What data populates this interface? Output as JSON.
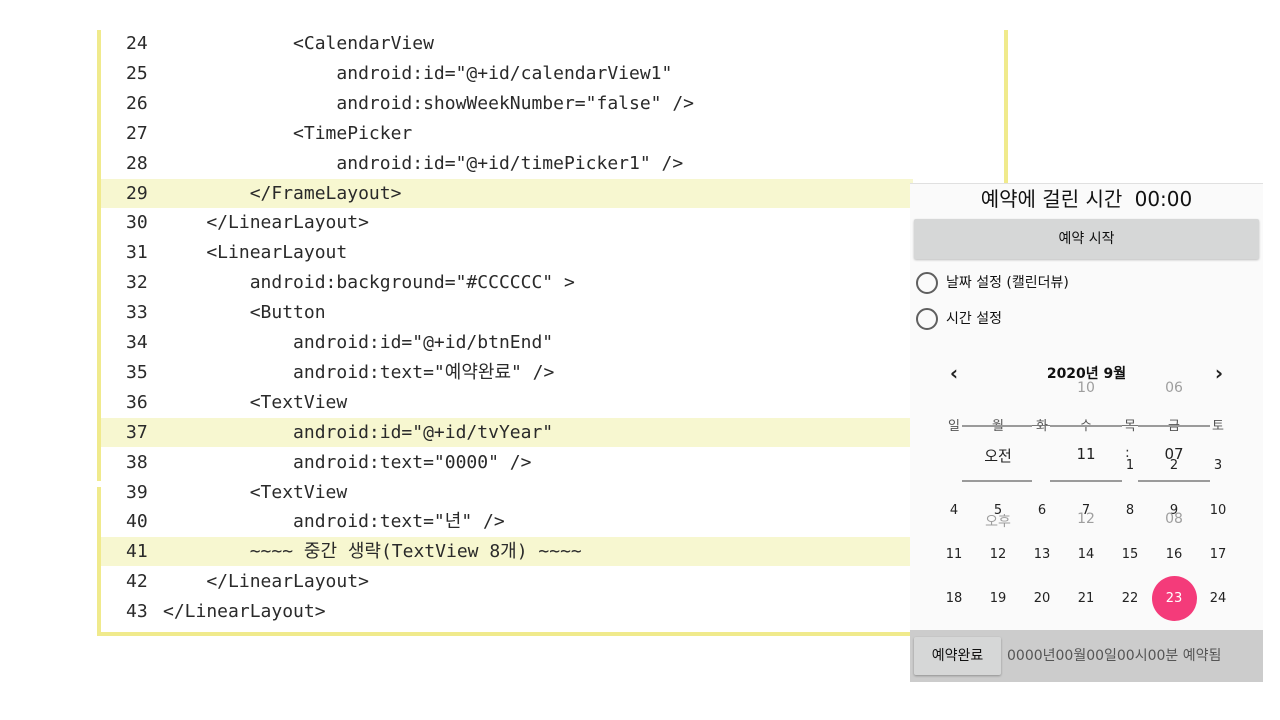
{
  "code": {
    "lines": [
      {
        "num": "24",
        "text": "            <CalendarView",
        "highlight": false
      },
      {
        "num": "25",
        "text": "                android:id=\"@+id/calendarView1\"",
        "highlight": false
      },
      {
        "num": "26",
        "text": "                android:showWeekNumber=\"false\" />",
        "highlight": false
      },
      {
        "num": "27",
        "text": "            <TimePicker",
        "highlight": false
      },
      {
        "num": "28",
        "text": "                android:id=\"@+id/timePicker1\" />",
        "highlight": false
      },
      {
        "num": "29",
        "text": "        </FrameLayout>",
        "highlight": true
      },
      {
        "num": "30",
        "text": "    </LinearLayout>",
        "highlight": false
      },
      {
        "num": "31",
        "text": "    <LinearLayout",
        "highlight": false
      },
      {
        "num": "32",
        "text": "        android:background=\"#CCCCCC\" >",
        "highlight": false
      },
      {
        "num": "33",
        "text": "        <Button",
        "highlight": false
      },
      {
        "num": "34",
        "text": "            android:id=\"@+id/btnEnd\"",
        "highlight": false
      },
      {
        "num": "35",
        "text": "            android:text=\"예약완료\" />",
        "highlight": false
      },
      {
        "num": "36",
        "text": "        <TextView",
        "highlight": false
      },
      {
        "num": "37",
        "text": "            android:id=\"@+id/tvYear\"",
        "highlight": true
      },
      {
        "num": "38",
        "text": "            android:text=\"0000\" />",
        "highlight": false
      },
      {
        "num": "39",
        "text": "        <TextView",
        "highlight": false
      },
      {
        "num": "40",
        "text": "            android:text=\"년\" />",
        "highlight": false
      },
      {
        "num": "41",
        "text": "        ~~~~ 중간 생략(TextView 8개) ~~~~",
        "highlight": true
      },
      {
        "num": "42",
        "text": "    </LinearLayout>",
        "highlight": false
      },
      {
        "num": "43",
        "text": "</LinearLayout>",
        "highlight": false
      }
    ]
  },
  "phone": {
    "elapsed_label": "예약에 걸린 시간",
    "elapsed_value": "00:00",
    "start_button": "예약 시작",
    "radio_date": "날짜 설정 (캘린더뷰)",
    "radio_time": "시간 설정",
    "calendar": {
      "title": "2020년 9월",
      "weekdays": [
        "일",
        "월",
        "화",
        "수",
        "목",
        "금",
        "토"
      ],
      "rows": [
        [
          "",
          "",
          "",
          "",
          "",
          "",
          "3"
        ],
        [
          "4",
          "5",
          "6",
          "7",
          "8",
          "9",
          "10"
        ],
        [
          "11",
          "12",
          "13",
          "14",
          "15",
          "16",
          "17"
        ],
        [
          "18",
          "19",
          "20",
          "21",
          "22",
          "23",
          "24"
        ]
      ],
      "row1_partial": [
        "1",
        "2"
      ],
      "selected_day": "23"
    },
    "time_picker": {
      "ampm_prev": "",
      "ampm_current": "오전",
      "ampm_next": "오후",
      "hour_prev": "10",
      "hour_current": "11",
      "hour_next": "12",
      "minute_prev": "06",
      "minute_current": "07",
      "minute_next": "08",
      "separator": ":"
    },
    "end_button": "예약완료",
    "result_text": "0000년00월00일00시00분 예약됨"
  },
  "colors": {
    "code_border": "#f0ea8c",
    "code_highlight": "#f7f7d0",
    "selected_day": "#f43b7a",
    "bottom_bar": "#cccccc"
  }
}
